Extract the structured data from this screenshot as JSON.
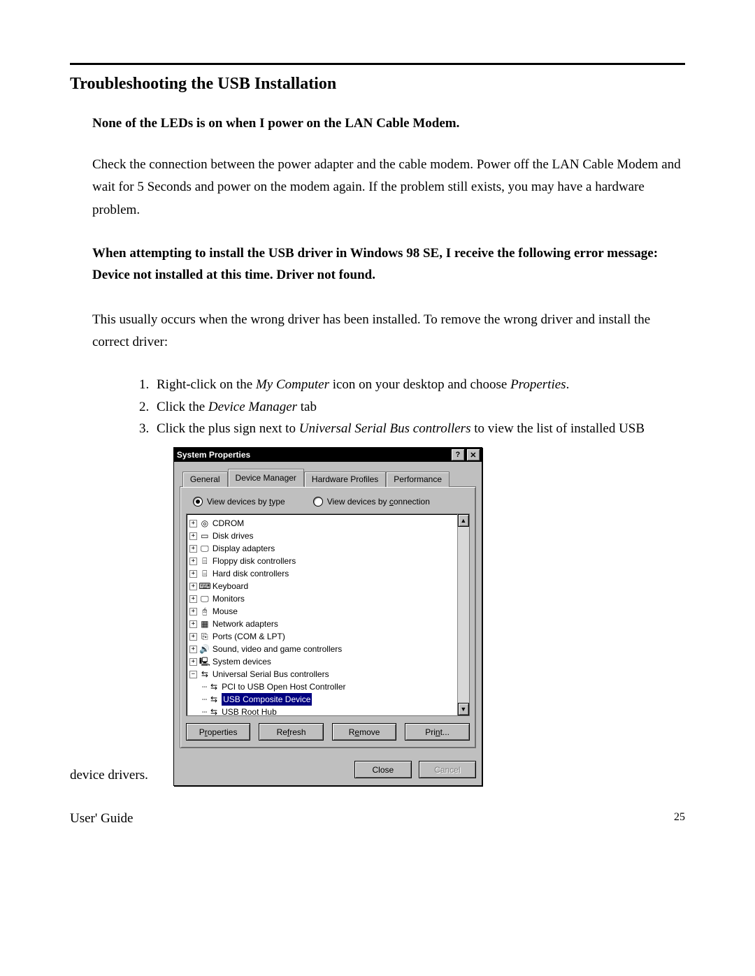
{
  "doc": {
    "section_title": "Troubleshooting the USB Installation",
    "q1_heading": "None of the LEDs is on when I power on the   LAN Cable Modem.",
    "q1_body": "Check the connection between the power adapter and the cable modem.  Power off the   LAN Cable Modem and wait for 5 Seconds and power on the modem again. If the problem still exists, you may have a hardware problem.",
    "q2_heading": "When attempting to install the USB driver in Windows 98 SE, I receive the following error message:  Device not installed at this time.  Driver not found.",
    "q2_body": "This usually occurs when the wrong driver has been installed.  To remove the wrong driver and install the correct driver:",
    "steps": {
      "s1_a": "Right-click on the ",
      "s1_b": "My Computer",
      "s1_c": " icon on your desktop and choose ",
      "s1_d": "Properties",
      "s1_e": ".",
      "s2_a": "Click the ",
      "s2_b": "Device Manager",
      "s2_c": " tab",
      "s3_a": "Click the plus sign next to ",
      "s3_b": "Universal Serial Bus controllers",
      "s3_c": " to view the list of installed USB"
    },
    "trailing_line": "device drivers.",
    "footer_left": "User' Guide",
    "footer_right": "25"
  },
  "dialog": {
    "title": "System Properties",
    "help_btn": "?",
    "close_btn": "✕",
    "tabs": [
      "General",
      "Device Manager",
      "Hardware Profiles",
      "Performance"
    ],
    "active_tab_index": 1,
    "radio": {
      "by_type_pre": "View devices by ",
      "by_type_u": "t",
      "by_type_post": "ype",
      "by_conn_pre": "View devices by ",
      "by_conn_u": "c",
      "by_conn_post": "onnection",
      "selected": "type"
    },
    "tree": [
      {
        "exp": "+",
        "icon": "cd-icon",
        "glyph": "◎",
        "label": "CDROM",
        "indent": 0
      },
      {
        "exp": "+",
        "icon": "disk-icon",
        "glyph": "▭",
        "label": "Disk drives",
        "indent": 0
      },
      {
        "exp": "+",
        "icon": "display-icon",
        "glyph": "🖵",
        "label": "Display adapters",
        "indent": 0
      },
      {
        "exp": "+",
        "icon": "floppy-icon",
        "glyph": "⌸",
        "label": "Floppy disk controllers",
        "indent": 0
      },
      {
        "exp": "+",
        "icon": "hdd-icon",
        "glyph": "⌸",
        "label": "Hard disk controllers",
        "indent": 0
      },
      {
        "exp": "+",
        "icon": "keyboard-icon",
        "glyph": "⌨",
        "label": "Keyboard",
        "indent": 0
      },
      {
        "exp": "+",
        "icon": "monitor-icon",
        "glyph": "🖵",
        "label": "Monitors",
        "indent": 0
      },
      {
        "exp": "+",
        "icon": "mouse-icon",
        "glyph": "🖰",
        "label": "Mouse",
        "indent": 0
      },
      {
        "exp": "+",
        "icon": "network-icon",
        "glyph": "▦",
        "label": "Network adapters",
        "indent": 0
      },
      {
        "exp": "+",
        "icon": "ports-icon",
        "glyph": "⎘",
        "label": "Ports (COM & LPT)",
        "indent": 0
      },
      {
        "exp": "+",
        "icon": "sound-icon",
        "glyph": "🔊",
        "label": "Sound, video and game controllers",
        "indent": 0
      },
      {
        "exp": "+",
        "icon": "system-icon",
        "glyph": "🖳",
        "label": "System devices",
        "indent": 0
      },
      {
        "exp": "−",
        "icon": "usb-icon",
        "glyph": "⇆",
        "label": "Universal Serial Bus controllers",
        "indent": 0
      },
      {
        "exp": "",
        "icon": "usb-host-icon",
        "glyph": "⇆",
        "label": "PCI to USB Open Host Controller",
        "indent": 1
      },
      {
        "exp": "",
        "icon": "usb-composite-icon",
        "glyph": "⇆",
        "label": "USB Composite Device",
        "indent": 1,
        "selected": true
      },
      {
        "exp": "",
        "icon": "usb-hub-icon",
        "glyph": "⇆",
        "label": "USB Root Hub",
        "indent": 1
      }
    ],
    "buttons": {
      "properties_pre": "P",
      "properties_u": "r",
      "properties_post": "operties",
      "refresh_pre": "Re",
      "refresh_u": "f",
      "refresh_post": "resh",
      "remove_pre": "R",
      "remove_u": "e",
      "remove_post": "move",
      "print_pre": "Pri",
      "print_u": "n",
      "print_post": "t...",
      "close": "Close",
      "cancel": "Cancel"
    },
    "scroll_up": "▲",
    "scroll_down": "▼"
  }
}
